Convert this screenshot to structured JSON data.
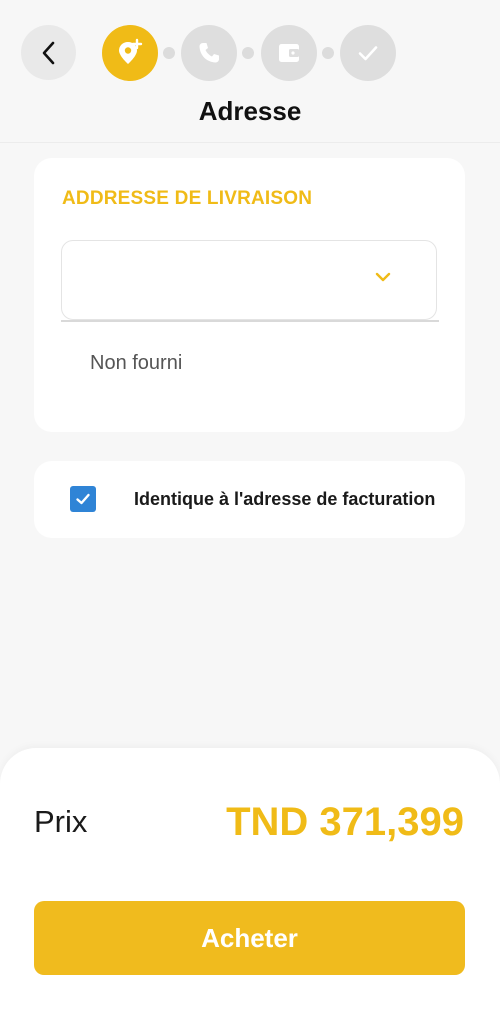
{
  "header": {
    "title": "Adresse",
    "steps": [
      {
        "name": "address",
        "icon": "map-pin-plus-icon",
        "active": true
      },
      {
        "name": "phone",
        "icon": "phone-icon",
        "active": false
      },
      {
        "name": "payment",
        "icon": "wallet-icon",
        "active": false
      },
      {
        "name": "confirm",
        "icon": "check-icon",
        "active": false
      }
    ]
  },
  "shipping": {
    "section_title": "ADDRESSE DE LIVRAISON",
    "selected_value": "",
    "not_provided": "Non fourni"
  },
  "billing": {
    "same_as_billing_label": "Identique à l'adresse de facturation",
    "checked": true
  },
  "footer": {
    "price_label": "Prix",
    "price_value": "TND 371,399",
    "buy_label": "Acheter"
  },
  "colors": {
    "accent": "#f0bb17",
    "checkbox": "#2f84d6",
    "step_inactive": "#dedede"
  }
}
